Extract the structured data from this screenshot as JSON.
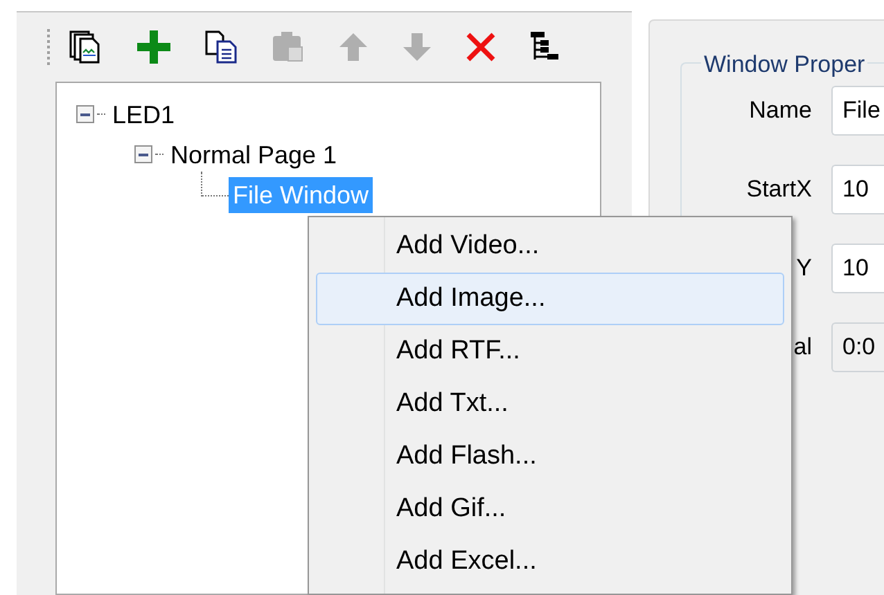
{
  "toolbar": [
    {
      "kind": "new-file",
      "disabled": false
    },
    {
      "kind": "add",
      "disabled": false
    },
    {
      "kind": "copy",
      "disabled": false
    },
    {
      "kind": "paste",
      "disabled": true
    },
    {
      "kind": "up",
      "disabled": true
    },
    {
      "kind": "down",
      "disabled": true
    },
    {
      "kind": "delete",
      "disabled": false
    },
    {
      "kind": "tree",
      "disabled": false
    }
  ],
  "tree": [
    {
      "label": "LED1",
      "expanded": true,
      "selected": false,
      "children": [
        {
          "label": "Normal Page 1",
          "expanded": true,
          "selected": false,
          "children": [
            {
              "label": "File Window",
              "selected": true
            }
          ]
        }
      ]
    }
  ],
  "properties": {
    "title": "Window Proper",
    "fields": [
      {
        "label": "Name",
        "value": "File",
        "disabled": false
      },
      {
        "label": "StartX",
        "value": "10",
        "disabled": false
      },
      {
        "label": "Y",
        "value": "10",
        "disabled": false
      },
      {
        "label": "al",
        "value": "0:0",
        "disabled": true
      }
    ]
  },
  "context_menu": [
    {
      "label": "Add Video...",
      "selected": false
    },
    {
      "label": "Add Image...",
      "selected": true
    },
    {
      "label": "Add RTF...",
      "selected": false
    },
    {
      "label": "Add Txt...",
      "selected": false
    },
    {
      "label": "Add Flash...",
      "selected": false
    },
    {
      "label": "Add Gif...",
      "selected": false
    },
    {
      "label": "Add Excel...",
      "selected": false
    }
  ]
}
